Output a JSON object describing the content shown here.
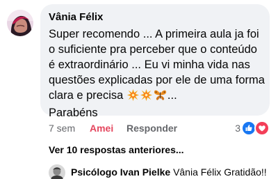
{
  "comment": {
    "author": "Vânia Félix",
    "text": "Super recomendo ... A primeira aula ja foi o suficiente pra perceber que o conteúdo é extraordinário ... Eu vi minha vida nas questões explicadas por ele de uma forma clara e precisa",
    "text_tail": "...",
    "text_end": "Parabéns",
    "emojis": [
      "collision-icon",
      "collision-icon",
      "butterfly-icon"
    ]
  },
  "actions": {
    "time": "7 sem",
    "like_label": "Amei",
    "reply_label": "Responder"
  },
  "reactions": {
    "count": "3",
    "icons": [
      "like-reaction-icon",
      "love-reaction-icon"
    ],
    "colors": {
      "like": "#1877f2",
      "love": "#f33e58"
    }
  },
  "view_more": "Ver 10 respostas anteriores...",
  "reply": {
    "author": "Psicólogo Ivan Pielke",
    "text": "Vânia Félix Gratidão!!"
  },
  "colors": {
    "bubble": "#f0f2f5",
    "love_accent": "#e4465e",
    "secondary_text": "#65676b"
  }
}
